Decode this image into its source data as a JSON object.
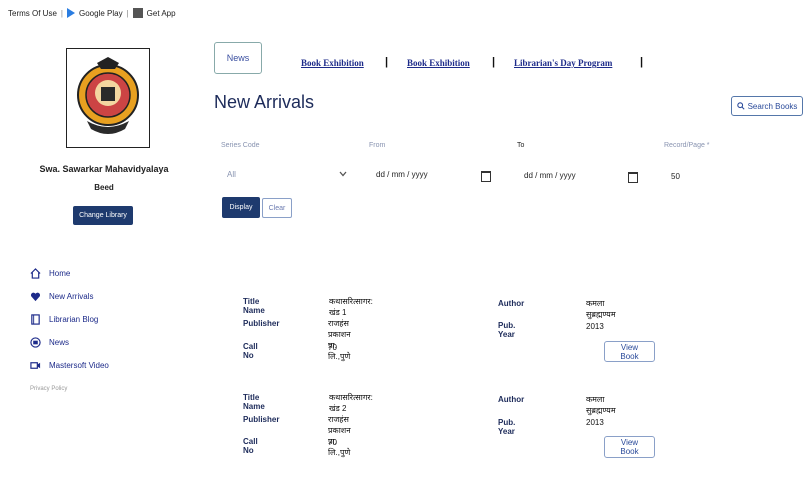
{
  "topbar": {
    "terms": "Terms Of Use",
    "google_play": "Google Play",
    "get_app": "Get App"
  },
  "sidebar": {
    "college_name": "Swa. Sawarkar Mahavidyalaya",
    "city": "Beed",
    "change_library": "Change Library",
    "items": [
      {
        "label": "Home",
        "icon": "home-icon"
      },
      {
        "label": "New Arrivals",
        "icon": "heart-icon"
      },
      {
        "label": "Librarian Blog",
        "icon": "book-icon"
      },
      {
        "label": "News",
        "icon": "news-icon"
      },
      {
        "label": "Mastersoft Video",
        "icon": "video-icon"
      }
    ],
    "privacy": "Privacy Policy"
  },
  "tabs": {
    "news": "News",
    "links": [
      "Book Exhibition",
      "Book Exhibition",
      "Librarian's Day Program"
    ]
  },
  "main": {
    "title": "New Arrivals",
    "search_books": "Search Books"
  },
  "filters": {
    "series_label": "Series Code",
    "series_value": "All",
    "from_label": "From",
    "from_value": "dd / mm / yyyy",
    "to_label": "To",
    "to_value": "dd / mm / yyyy",
    "records_label": "Record/Page *",
    "records_value": "50",
    "display": "Display",
    "clear": "Clear"
  },
  "labels": {
    "title_name": "Title Name",
    "publisher": "Publisher",
    "call_no": "Call No",
    "author": "Author",
    "pub_year": "Pub. Year",
    "view_book": "View Book"
  },
  "books": [
    {
      "title": "कथासरित्सागर: खंड 1",
      "publisher": "राजहंस प्रकाशन प्रा. लि.,पुणे",
      "call_no": "70",
      "author": "कमला सुब्रह्मण्यम",
      "year": "2013"
    },
    {
      "title": "कथासरित्सागर: खंड 2",
      "publisher": "राजहंस प्रकाशन प्रा. लि.,पुणे",
      "call_no": "70",
      "author": "कमला सुब्रह्मण्यम",
      "year": "2013"
    }
  ],
  "colors": {
    "primary": "#1e3a6e",
    "link": "#1d2b8a"
  }
}
